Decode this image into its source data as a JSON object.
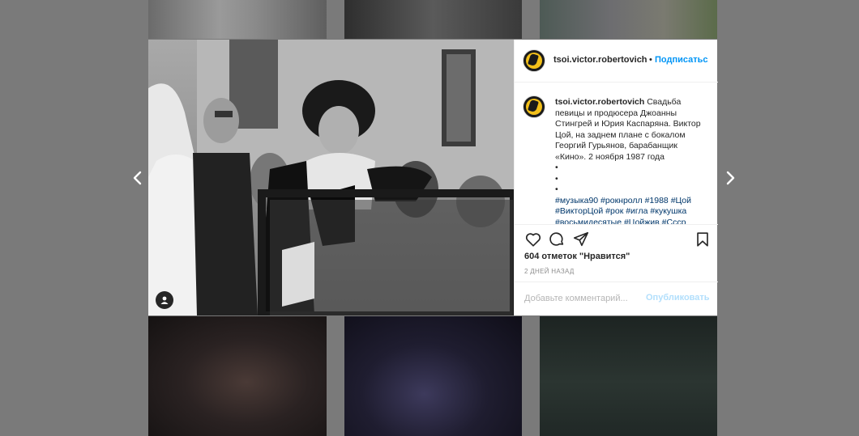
{
  "post": {
    "username": "tsoi.victor.robertovich",
    "dot": "•",
    "follow_label": "Подписаться",
    "caption_text": "Свадьба певицы и продюсера Джоанны Стингрей и Юрия Каспаряна. Виктор Цой, на заднем плане с бокалом Георгий Гурьянов, барабанщик «Кино». 2 ноября 1987 года",
    "bullets": [
      "•",
      "•",
      "•"
    ],
    "hashtags_line1": "#музыка90 #рокнролл #1988 #Цой",
    "hashtags_line2": "#ВикторЦой #рок #игла #кукушка",
    "hashtags_line3": "#восьмидесятые #Цойжив #Ссср #чест",
    "likes": "604 отметок \"Нравится\"",
    "timestamp": "2 ДНЕЙ НАЗАД",
    "comment_placeholder": "Добавьте комментарий...",
    "publish_label": "Опубликовать"
  },
  "nav": {
    "prev_glyph": "‹",
    "next_glyph": "›"
  },
  "icons": {
    "like": "heart-icon",
    "comment": "comment-bubble-icon",
    "share": "paper-plane-icon",
    "save": "bookmark-icon",
    "user_tag": "user-icon"
  },
  "colors": {
    "backdrop": "#7a7a7a",
    "link_blue": "#0095f6",
    "hashtag": "#00376b",
    "publish_disabled": "#b2dffc",
    "avatar_yellow": "#f3c01a"
  }
}
